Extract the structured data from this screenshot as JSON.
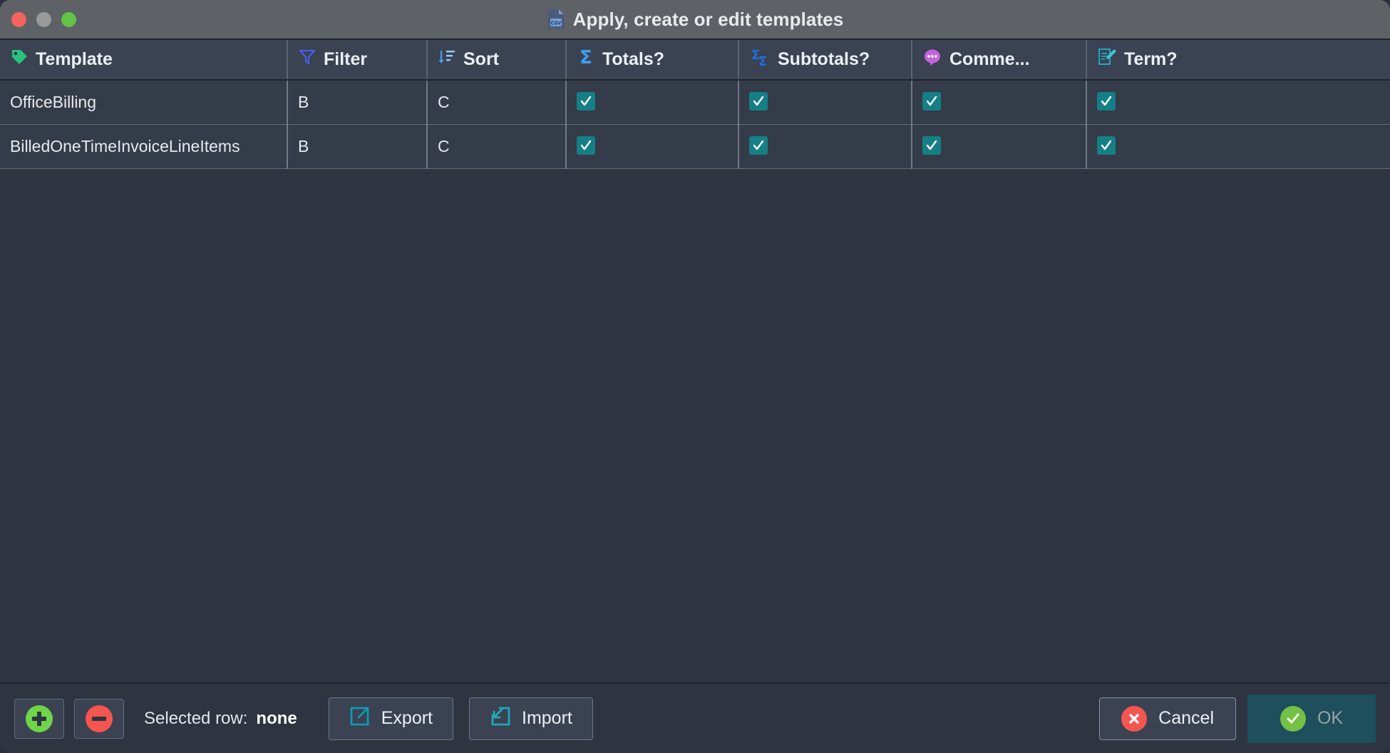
{
  "window": {
    "title": "Apply, create or edit templates",
    "icon": "csv-file-icon",
    "traffic_lights": [
      "close",
      "minimize",
      "maximize"
    ]
  },
  "table": {
    "columns": [
      {
        "label": "Template",
        "icon": "tag-icon",
        "icon_color": "#25c37e"
      },
      {
        "label": "Filter",
        "icon": "funnel-icon",
        "icon_color": "#4663ee"
      },
      {
        "label": "Sort",
        "icon": "sort-descending-icon",
        "icon_color": "#3ea0f5"
      },
      {
        "label": "Totals?",
        "icon": "sigma-icon",
        "icon_color": "#3ea0f5"
      },
      {
        "label": "Subtotals?",
        "icon": "double-sigma-icon",
        "icon_color": "#1f6fe0"
      },
      {
        "label": "Comme...",
        "icon": "comment-bubble-icon",
        "icon_color": "#c562e0"
      },
      {
        "label": "Term?",
        "icon": "edit-document-icon",
        "icon_color": "#1fa8bd"
      }
    ],
    "rows": [
      {
        "template": "OfficeBilling",
        "filter": "B",
        "sort": "C",
        "totals": true,
        "subtotals": true,
        "comments": true,
        "term": true
      },
      {
        "template": "BilledOneTimeInvoiceLineItems",
        "filter": "B",
        "sort": "C",
        "totals": true,
        "subtotals": true,
        "comments": true,
        "term": true
      }
    ]
  },
  "bottom_bar": {
    "add_button": {
      "icon": "plus-circle-icon",
      "color": "#6fd44a"
    },
    "remove_button": {
      "icon": "minus-circle-icon",
      "color": "#f4564f"
    },
    "selected_row_label": "Selected row:",
    "selected_row_value": "none",
    "export_button": {
      "label": "Export",
      "icon": "export-arrow-icon",
      "color": "#0e9bb2"
    },
    "import_button": {
      "label": "Import",
      "icon": "import-arrow-icon",
      "color": "#1fa8bd"
    },
    "cancel_button": {
      "label": "Cancel",
      "icon": "cancel-x-icon",
      "color": "#f4564f"
    },
    "ok_button": {
      "label": "OK",
      "icon": "check-circle-icon",
      "color": "#74bf45",
      "enabled": false
    }
  },
  "colors": {
    "window_bg": "#2e3440",
    "titlebar_bg": "#5e6165",
    "header_bg": "#3b4252",
    "row_bg": "#343b49",
    "checkbox": "#157f86",
    "ok_bg": "#1d4f5c"
  }
}
